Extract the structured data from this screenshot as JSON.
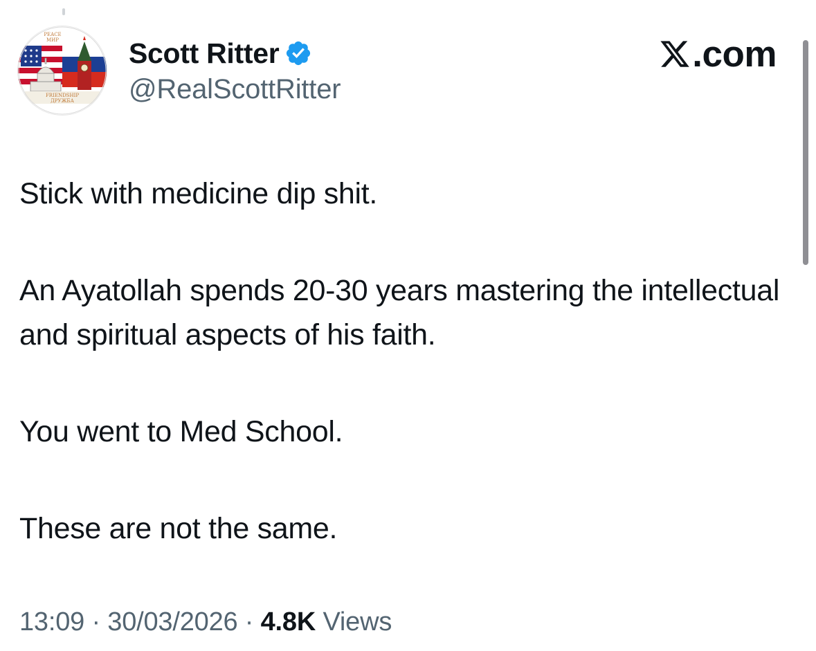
{
  "author": {
    "display_name": "Scott Ritter",
    "handle": "@RealScottRitter",
    "avatar_text": [
      "PEACE",
      "МИР",
      "FRIENDSHIP",
      "ДРУЖБА"
    ]
  },
  "brand": {
    "domain": ".com",
    "logo": "x-logo-icon"
  },
  "tweet": {
    "paragraphs": [
      "Stick with medicine dip shit.",
      "An Ayatollah spends 20-30 years mastering the intellectual and spiritual aspects of his faith.",
      "You went to Med School.",
      "These are not the same."
    ]
  },
  "meta": {
    "time": "13:09",
    "separator": " · ",
    "date": "30/03/2026",
    "views_count": "4.8K",
    "views_label": " Views"
  },
  "icons": {
    "verified": "verified-badge-icon",
    "x_logo": "x-logo-icon"
  },
  "colors": {
    "verified_blue": "#1d9bf0",
    "text_primary": "#0f1419",
    "text_secondary": "#536471"
  }
}
